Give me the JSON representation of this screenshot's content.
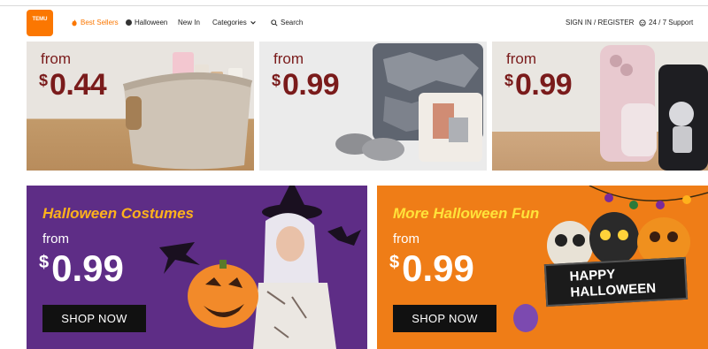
{
  "header": {
    "logo_text": "TEMU",
    "nav": {
      "best_sellers": "Best Sellers",
      "halloween": "Halloween",
      "new_in": "New In",
      "categories": "Categories",
      "search": "Search",
      "sign_in": "SIGN IN / REGISTER",
      "support": "24 / 7 Support"
    }
  },
  "tiles": [
    {
      "from": "from",
      "currency": "$",
      "price": "0.44"
    },
    {
      "from": "from",
      "currency": "$",
      "price": "0.99"
    },
    {
      "from": "from",
      "currency": "$",
      "price": "0.99"
    }
  ],
  "banners": [
    {
      "headline": "Halloween Costumes",
      "from": "from",
      "currency": "$",
      "price": "0.99",
      "button": "SHOP NOW"
    },
    {
      "headline": "More Halloween Fun",
      "from": "from",
      "currency": "$",
      "price": "0.99",
      "button": "SHOP NOW",
      "sign_text_1": "HAPPY",
      "sign_text_2": "HALLOWEEN"
    }
  ],
  "colors": {
    "brand": "#fb7701",
    "price": "#7a1b1b",
    "purple_banner": "#5e2d86",
    "orange_banner": "#ef7d17"
  },
  "icons": [
    "flame-icon",
    "pumpkin-icon",
    "chevron-down-icon",
    "search-icon",
    "headset-icon"
  ]
}
